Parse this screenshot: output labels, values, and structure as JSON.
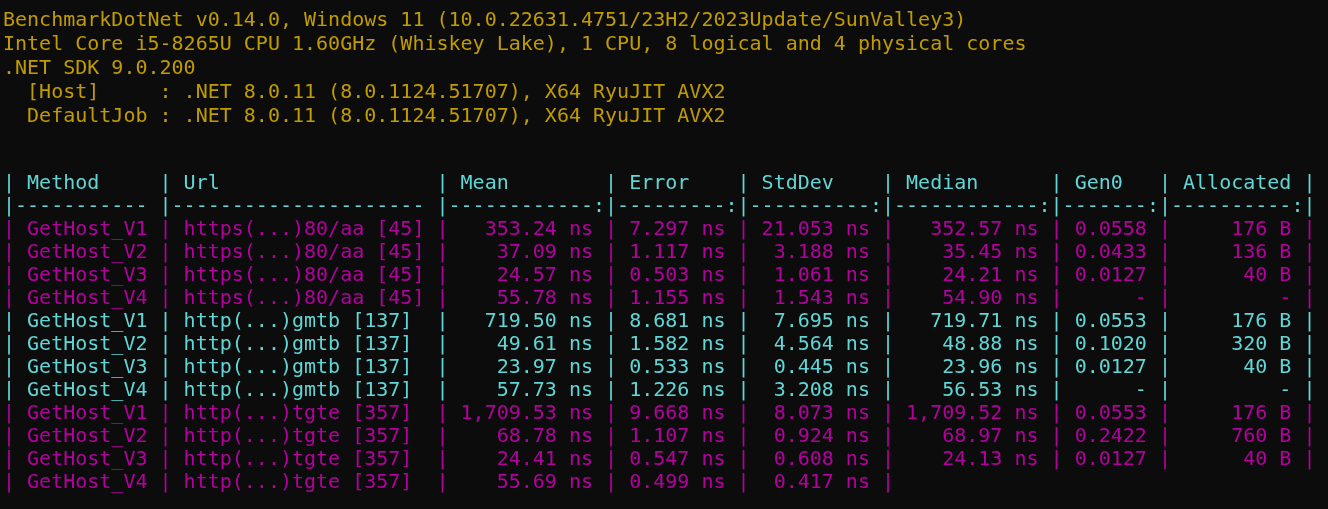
{
  "info_lines": [
    "BenchmarkDotNet v0.14.0, Windows 11 (10.0.22631.4751/23H2/2023Update/SunValley3)",
    "Intel Core i5-8265U CPU 1.60GHz (Whiskey Lake), 1 CPU, 8 logical and 4 physical cores",
    ".NET SDK 9.0.200",
    "  [Host]     : .NET 8.0.11 (8.0.1124.51707), X64 RyuJIT AVX2",
    "  DefaultJob : .NET 8.0.11 (8.0.1124.51707), X64 RyuJIT AVX2"
  ],
  "table": {
    "header": {
      "text": "| Method     | Url                  | Mean        | Error    | StdDev    | Median      | Gen0   | Allocated |",
      "color": "#61d6d6"
    },
    "separator": {
      "text": "|----------- |--------------------- |------------:|---------:|----------:|------------:|-------:|----------:|",
      "color": "#61d6d6"
    },
    "rows": [
      {
        "text": "| GetHost_V1 | https(...)80/aa [45] |   353.24 ns | 7.297 ns | 21.053 ns |   352.57 ns | 0.0558 |     176 B |",
        "color": "#b4009e"
      },
      {
        "text": "| GetHost_V2 | https(...)80/aa [45] |    37.09 ns | 1.117 ns |  3.188 ns |    35.45 ns | 0.0433 |     136 B |",
        "color": "#b4009e"
      },
      {
        "text": "| GetHost_V3 | https(...)80/aa [45] |    24.57 ns | 0.503 ns |  1.061 ns |    24.21 ns | 0.0127 |      40 B |",
        "color": "#b4009e"
      },
      {
        "text": "| GetHost_V4 | https(...)80/aa [45] |    55.78 ns | 1.155 ns |  1.543 ns |    54.90 ns |      - |         - |",
        "color": "#b4009e"
      },
      {
        "text": "| GetHost_V1 | http(...)gmtb [137]  |   719.50 ns | 8.681 ns |  7.695 ns |   719.71 ns | 0.0553 |     176 B |",
        "color": "#61d6d6"
      },
      {
        "text": "| GetHost_V2 | http(...)gmtb [137]  |    49.61 ns | 1.582 ns |  4.564 ns |    48.88 ns | 0.1020 |     320 B |",
        "color": "#61d6d6"
      },
      {
        "text": "| GetHost_V3 | http(...)gmtb [137]  |    23.97 ns | 0.533 ns |  0.445 ns |    23.96 ns | 0.0127 |      40 B |",
        "color": "#61d6d6"
      },
      {
        "text": "| GetHost_V4 | http(...)gmtb [137]  |    57.73 ns | 1.226 ns |  3.208 ns |    56.53 ns |      - |         - |",
        "color": "#61d6d6"
      },
      {
        "text": "| GetHost_V1 | http(...)tgte [357]  | 1,709.53 ns | 9.668 ns |  8.073 ns | 1,709.52 ns | 0.0553 |     176 B |",
        "color": "#b4009e"
      },
      {
        "text": "| GetHost_V2 | http(...)tgte [357]  |    68.78 ns | 1.107 ns |  0.924 ns |    68.97 ns | 0.2422 |     760 B |",
        "color": "#b4009e"
      },
      {
        "text": "| GetHost_V3 | http(...)tgte [357]  |    24.41 ns | 0.547 ns |  0.608 ns |    24.13 ns | 0.0127 |      40 B |",
        "color": "#b4009e"
      },
      {
        "text": "| GetHost_V4 | http(...)tgte [357]  |    55.69 ns | 0.499 ns |  0.417 ns |",
        "color": "#b4009e"
      }
    ]
  }
}
